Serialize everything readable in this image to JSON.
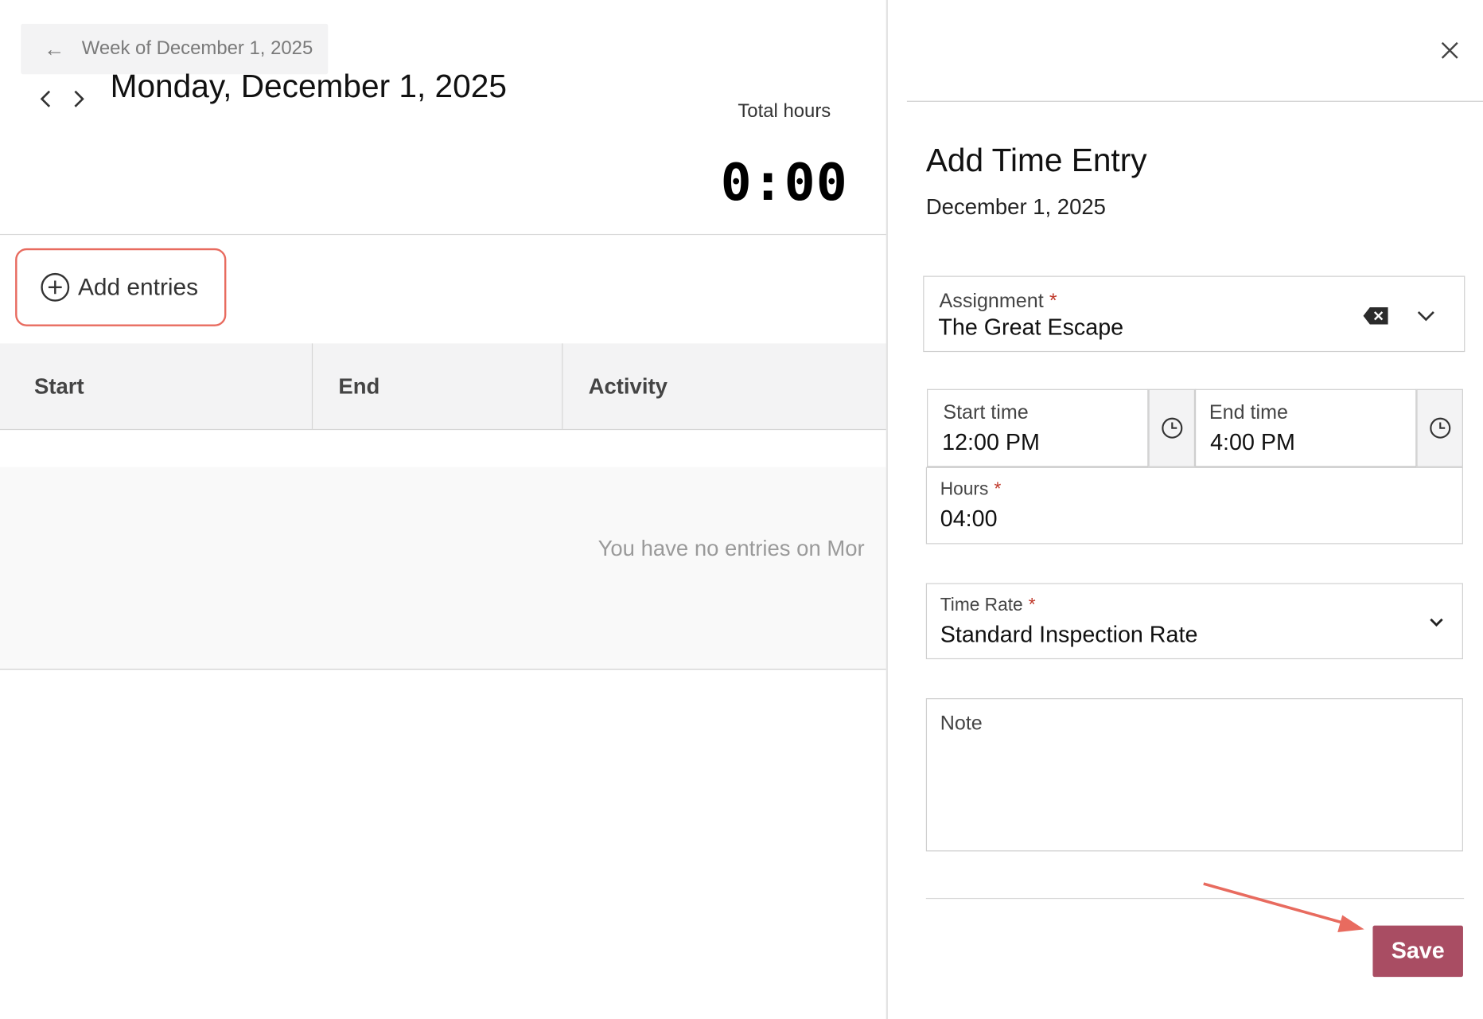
{
  "header": {
    "back_label": "Week of December 1, 2025",
    "page_title": "Monday, December 1, 2025",
    "total_hours_label": "Total hours",
    "total_hours_value": "0:00"
  },
  "toolbar": {
    "add_entries_label": "Add entries"
  },
  "table": {
    "columns": [
      "Start",
      "End",
      "Activity"
    ],
    "empty_message": "You have no entries on Mor"
  },
  "panel": {
    "title": "Add Time Entry",
    "date": "December 1, 2025",
    "assignment": {
      "label": "Assignment",
      "required": "*",
      "value": "The Great Escape"
    },
    "start_time": {
      "label": "Start time",
      "value": "12:00 PM"
    },
    "end_time": {
      "label": "End time",
      "value": "4:00 PM"
    },
    "hours": {
      "label": "Hours",
      "required": "*",
      "value": "04:00"
    },
    "time_rate": {
      "label": "Time Rate",
      "required": "*",
      "value": "Standard Inspection Rate"
    },
    "note": {
      "label": "Note",
      "value": ""
    },
    "save_label": "Save"
  },
  "colors": {
    "highlight": "#e86b5f",
    "save_button": "#a94d63",
    "required_marker": "#c0392b"
  },
  "icons": [
    "arrow-left-icon",
    "chevron-left-icon",
    "chevron-right-icon",
    "plus-circle-icon",
    "close-icon",
    "clear-icon",
    "chevron-down-icon",
    "clock-icon"
  ]
}
